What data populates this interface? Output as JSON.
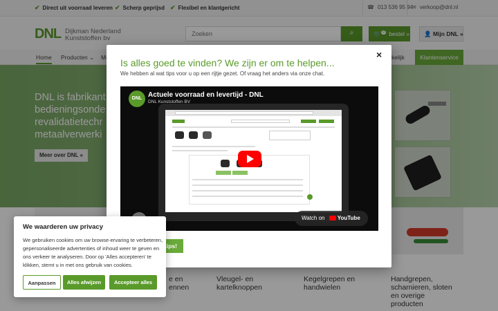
{
  "topbar": {
    "usps": [
      "Direct uit voorraad leveren",
      "Scherp geprijsd",
      "Flexibel en klantgericht"
    ],
    "phone": "013 536 95 94",
    "email": "verkoop@dnl.nl"
  },
  "header": {
    "logo_mark": "DNL",
    "logo_line1": "Dijkman Nederland",
    "logo_line2": "Kunststoffen bv",
    "search_placeholder": "Zoeken",
    "cart_count": "0",
    "cart_label": "bestel »",
    "account_label": "Mijn DNL »"
  },
  "nav": {
    "items": [
      "Home",
      "Producten",
      "Me",
      "kelijk"
    ],
    "service": "Klantenservice"
  },
  "hero": {
    "title": "DNL is fabrikant bedieningsonde revalidatietechr metaalverwerki",
    "button": "Meer over DNL »"
  },
  "categories": [
    "e en\nennen",
    "Vleugel- en\nkartelknoppen",
    "Kegelgrepen en\nhandwielen",
    "Handgrepen,\nscharnieren, sloten\nen overige\nproducten"
  ],
  "modal": {
    "title": "Is alles goed te vinden? We zijn er om te helpen...",
    "subtitle": "We hebben al wat tips voor u op een rijtje gezet. Of vraag het anders via onze chat.",
    "close": "×",
    "video": {
      "avatar": "DNL",
      "title": "Actuele voorraad en levertijd - DNL",
      "channel": "DNL Kunststoffen BV",
      "watch_on": "Watch on",
      "youtube": "YouTube"
    },
    "cta": "tips!"
  },
  "cookie": {
    "title": "We waarderen uw privacy",
    "text": "We gebruiken cookies om uw browse-ervaring te verbeteren, gepersonaliseerde advertenties of inhoud weer te geven en ons verkeer te analyseren. Door op 'Alles accepteren' te klikken, stemt u in met ons gebruik van cookies.",
    "customize": "Aanpassen",
    "reject": "Alles afwijzen",
    "accept": "Accepteer alles"
  },
  "colors": {
    "brand_green": "#5a9a2a",
    "light_green": "#6aaa3a",
    "youtube_red": "#ff0000"
  }
}
